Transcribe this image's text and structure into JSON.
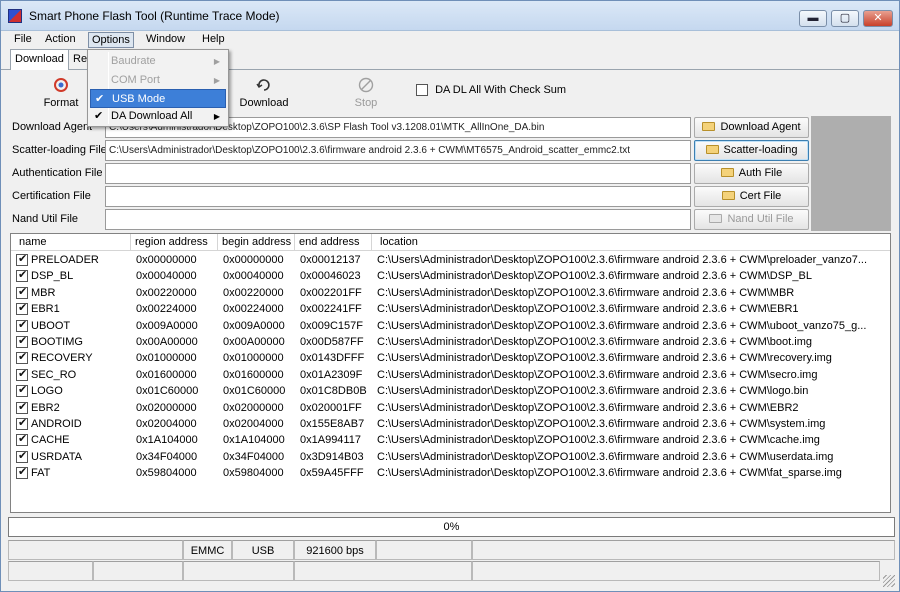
{
  "window": {
    "title": "Smart Phone Flash Tool (Runtime Trace Mode)",
    "controls": {
      "minimize": "▬",
      "maximize": "▢",
      "close": "✕"
    }
  },
  "menubar": {
    "items": [
      "File",
      "Action",
      "Options",
      "Window",
      "Help"
    ],
    "active": "Options"
  },
  "tabs": [
    "Download",
    "Re"
  ],
  "toolbar": {
    "format": "Format",
    "download": "Download",
    "stop": "Stop",
    "da_dl_all_label": "DA DL All With Check Sum",
    "da_dl_all_checked": false,
    "icons": {
      "format": "format-icon",
      "download": "download-icon",
      "stop": "stop-icon"
    }
  },
  "options_menu": {
    "items": [
      {
        "label": "Baudrate",
        "checked": false,
        "enabled": false,
        "submenu": true
      },
      {
        "label": "COM Port",
        "checked": false,
        "enabled": false,
        "submenu": true
      },
      {
        "label": "USB Mode",
        "checked": true,
        "enabled": true,
        "submenu": false,
        "highlighted": true
      },
      {
        "label": "DA Download All",
        "checked": true,
        "enabled": true,
        "submenu": true
      }
    ]
  },
  "files": [
    {
      "label": "Download Agent",
      "value": "C:\\Users\\Administrador\\Desktop\\ZOPO100\\2.3.6\\SP Flash Tool v3.1208.01\\MTK_AllInOne_DA.bin",
      "button": "Download Agent",
      "enabled": true
    },
    {
      "label": "Scatter-loading File",
      "value": "C:\\Users\\Administrador\\Desktop\\ZOPO100\\2.3.6\\firmware android 2.3.6 + CWM\\MT6575_Android_scatter_emmc2.txt",
      "button": "Scatter-loading",
      "enabled": true
    },
    {
      "label": "Authentication File",
      "value": "",
      "button": "Auth File",
      "enabled": true
    },
    {
      "label": "Certification File",
      "value": "",
      "button": "Cert File",
      "enabled": true
    },
    {
      "label": "Nand Util File",
      "value": "",
      "button": "Nand Util File",
      "enabled": false
    }
  ],
  "table": {
    "columns": [
      "name",
      "region address",
      "begin address",
      "end address",
      "location"
    ],
    "rows": [
      {
        "checked": true,
        "name": "PRELOADER",
        "region": "0x00000000",
        "begin": "0x00000000",
        "end": "0x00012137",
        "location": "C:\\Users\\Administrador\\Desktop\\ZOPO100\\2.3.6\\firmware android 2.3.6 + CWM\\preloader_vanzo7..."
      },
      {
        "checked": true,
        "name": "DSP_BL",
        "region": "0x00040000",
        "begin": "0x00040000",
        "end": "0x00046023",
        "location": "C:\\Users\\Administrador\\Desktop\\ZOPO100\\2.3.6\\firmware android 2.3.6 + CWM\\DSP_BL"
      },
      {
        "checked": true,
        "name": "MBR",
        "region": "0x00220000",
        "begin": "0x00220000",
        "end": "0x002201FF",
        "location": "C:\\Users\\Administrador\\Desktop\\ZOPO100\\2.3.6\\firmware android 2.3.6 + CWM\\MBR"
      },
      {
        "checked": true,
        "name": "EBR1",
        "region": "0x00224000",
        "begin": "0x00224000",
        "end": "0x002241FF",
        "location": "C:\\Users\\Administrador\\Desktop\\ZOPO100\\2.3.6\\firmware android 2.3.6 + CWM\\EBR1"
      },
      {
        "checked": true,
        "name": "UBOOT",
        "region": "0x009A0000",
        "begin": "0x009A0000",
        "end": "0x009C157F",
        "location": "C:\\Users\\Administrador\\Desktop\\ZOPO100\\2.3.6\\firmware android 2.3.6 + CWM\\uboot_vanzo75_g..."
      },
      {
        "checked": true,
        "name": "BOOTIMG",
        "region": "0x00A00000",
        "begin": "0x00A00000",
        "end": "0x00D587FF",
        "location": "C:\\Users\\Administrador\\Desktop\\ZOPO100\\2.3.6\\firmware android 2.3.6 + CWM\\boot.img"
      },
      {
        "checked": true,
        "name": "RECOVERY",
        "region": "0x01000000",
        "begin": "0x01000000",
        "end": "0x0143DFFF",
        "location": "C:\\Users\\Administrador\\Desktop\\ZOPO100\\2.3.6\\firmware android 2.3.6 + CWM\\recovery.img"
      },
      {
        "checked": true,
        "name": "SEC_RO",
        "region": "0x01600000",
        "begin": "0x01600000",
        "end": "0x01A2309F",
        "location": "C:\\Users\\Administrador\\Desktop\\ZOPO100\\2.3.6\\firmware android 2.3.6 + CWM\\secro.img"
      },
      {
        "checked": true,
        "name": "LOGO",
        "region": "0x01C60000",
        "begin": "0x01C60000",
        "end": "0x01C8DB0B",
        "location": "C:\\Users\\Administrador\\Desktop\\ZOPO100\\2.3.6\\firmware android 2.3.6 + CWM\\logo.bin"
      },
      {
        "checked": true,
        "name": "EBR2",
        "region": "0x02000000",
        "begin": "0x02000000",
        "end": "0x020001FF",
        "location": "C:\\Users\\Administrador\\Desktop\\ZOPO100\\2.3.6\\firmware android 2.3.6 + CWM\\EBR2"
      },
      {
        "checked": true,
        "name": "ANDROID",
        "region": "0x02004000",
        "begin": "0x02004000",
        "end": "0x155E8AB7",
        "location": "C:\\Users\\Administrador\\Desktop\\ZOPO100\\2.3.6\\firmware android 2.3.6 + CWM\\system.img"
      },
      {
        "checked": true,
        "name": "CACHE",
        "region": "0x1A104000",
        "begin": "0x1A104000",
        "end": "0x1A994117",
        "location": "C:\\Users\\Administrador\\Desktop\\ZOPO100\\2.3.6\\firmware android 2.3.6 + CWM\\cache.img"
      },
      {
        "checked": true,
        "name": "USRDATA",
        "region": "0x34F04000",
        "begin": "0x34F04000",
        "end": "0x3D914B03",
        "location": "C:\\Users\\Administrador\\Desktop\\ZOPO100\\2.3.6\\firmware android 2.3.6 + CWM\\userdata.img"
      },
      {
        "checked": true,
        "name": "FAT",
        "region": "0x59804000",
        "begin": "0x59804000",
        "end": "0x59A45FFF",
        "location": "C:\\Users\\Administrador\\Desktop\\ZOPO100\\2.3.6\\firmware android 2.3.6 + CWM\\fat_sparse.img"
      }
    ]
  },
  "progress": {
    "text": "0%",
    "value": 0,
    "color": "#3cb043"
  },
  "statusbar": {
    "row1": [
      "",
      "EMMC",
      "USB",
      "921600 bps",
      "",
      ""
    ],
    "row2": [
      "",
      "",
      "",
      "",
      "",
      ""
    ]
  },
  "colors": {
    "menu_highlight": "#3d7fd8",
    "window_bg": "#f0f0f0"
  }
}
